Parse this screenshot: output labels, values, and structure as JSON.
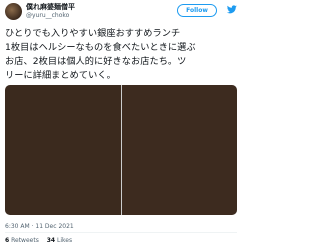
{
  "header": {
    "display_name": "僕れ麻婆麺僧平",
    "handle": "@yuru__choko",
    "follow_label": "Follow"
  },
  "tweet": {
    "lines": [
      "ひとりでも入りやすい銀座おすすめランチ",
      "1枚目はヘルシーなものを食べたいときに選ぶ",
      "お店、2枚目は個人的に好きなお店たち。ツ",
      "リーに詳細まとめていく。"
    ],
    "timestamp": "6:30 AM · 11 Dec 2021",
    "retweets_count": "6",
    "retweets_label": "Retweets",
    "likes_count": "34",
    "likes_label": "Likes"
  },
  "colors": {
    "accent": "#1d9bf0",
    "text": "#0f1419",
    "muted": "#536471",
    "image_left": "#3b2a1e",
    "image_right": "#3d2b1f"
  },
  "icons": [
    "avatar",
    "twitter-bird-icon"
  ]
}
